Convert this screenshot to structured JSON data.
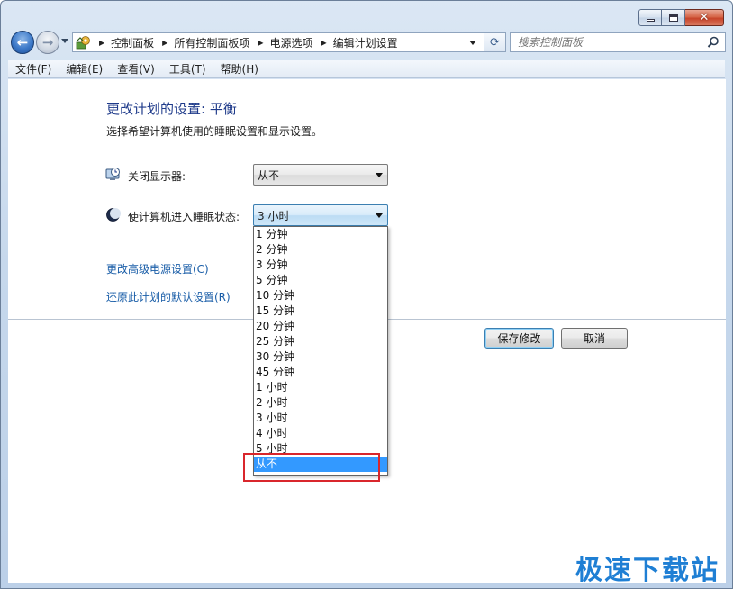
{
  "window": {
    "controls": {
      "minimize_icon": "minimize-icon",
      "maximize_icon": "maximize-icon",
      "close_icon": "close-icon"
    }
  },
  "nav": {
    "back_glyph": "←",
    "forward_glyph": "→",
    "breadcrumbs": [
      "控制面板",
      "所有控制面板项",
      "电源选项",
      "编辑计划设置"
    ],
    "refresh_glyph": "⟳",
    "search_placeholder": "搜索控制面板"
  },
  "menu": {
    "items": [
      "文件(F)",
      "编辑(E)",
      "查看(V)",
      "工具(T)",
      "帮助(H)"
    ]
  },
  "main": {
    "title": "更改计划的设置: 平衡",
    "subtitle": "选择希望计算机使用的睡眠设置和显示设置。",
    "display_off": {
      "label": "关闭显示器:",
      "value": "从不",
      "icon": "monitor-clock-icon"
    },
    "sleep": {
      "label": "使计算机进入睡眠状态:",
      "value": "3 小时",
      "icon": "moon-sleep-icon"
    },
    "link_advanced": "更改高级电源设置(C)",
    "link_restore": "还原此计划的默认设置(R)",
    "save_button": "保存修改",
    "cancel_button": "取消"
  },
  "dropdown": {
    "options": [
      "1 分钟",
      "2 分钟",
      "3 分钟",
      "5 分钟",
      "10 分钟",
      "15 分钟",
      "20 分钟",
      "25 分钟",
      "30 分钟",
      "45 分钟",
      "1 小时",
      "2 小时",
      "3 小时",
      "4 小时",
      "5 小时",
      "从不"
    ],
    "selected_index": 15
  },
  "watermark": "极速下载站",
  "colors": {
    "accent": "#3399ff",
    "link": "#1a5ea8",
    "title": "#1e3a8a",
    "highlight": "#d9262c",
    "watermark": "#1f7fd4"
  }
}
